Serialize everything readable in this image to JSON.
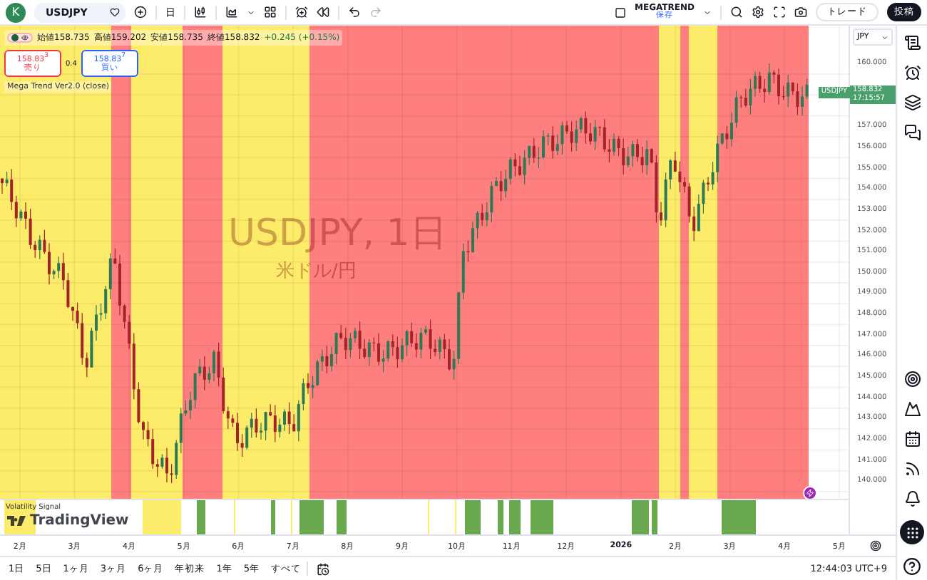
{
  "toolbar": {
    "avatar": "K",
    "symbol": "USDJPY",
    "interval": "日",
    "layout_name": "MEGATREND",
    "layout_status": "保存",
    "trade_button": "トレード",
    "publish_button": "投稿"
  },
  "legend": {
    "visible": true,
    "ohlc": [
      {
        "label": "始値",
        "value": "158.735"
      },
      {
        "label": "高値",
        "value": "159.202"
      },
      {
        "label": "安値",
        "value": "158.735"
      },
      {
        "label": "終値",
        "value": "158.832"
      }
    ],
    "change": "+0.245 (+0.15%)",
    "sell": {
      "price": "158.83$^{3}$",
      "label": "売り"
    },
    "spread": "0.4",
    "buy": {
      "price": "158.83$^{7}$",
      "label": "買い"
    },
    "indicator": "Mega Trend Ver2.0 (close)"
  },
  "watermark": {
    "symbol": "USDJPY, 1日",
    "name": "米ドル/円"
  },
  "price_axis": {
    "currency": "JPY",
    "ticks_above": [
      "160.000"
    ],
    "ticks": [
      "157.000",
      "156.000",
      "155.000",
      "154.000",
      "153.000",
      "152.000",
      "151.000",
      "150.000",
      "149.000",
      "148.000",
      "147.000",
      "146.000",
      "145.000",
      "144.000",
      "143.000",
      "142.000",
      "141.000",
      "140.000"
    ],
    "last_price": {
      "symbol": "USDJPY",
      "price": "158.832",
      "countdown": "17:15:57"
    }
  },
  "indicator_pane": {
    "title": "Volatility Signal",
    "logo_text": "TradingView"
  },
  "time_axis": {
    "labels": [
      {
        "text": "2月",
        "year": false
      },
      {
        "text": "3月",
        "year": false
      },
      {
        "text": "4月",
        "year": false
      },
      {
        "text": "5月",
        "year": false
      },
      {
        "text": "6月",
        "year": false
      },
      {
        "text": "7月",
        "year": false
      },
      {
        "text": "8月",
        "year": false
      },
      {
        "text": "9月",
        "year": false
      },
      {
        "text": "10月",
        "year": false
      },
      {
        "text": "11月",
        "year": false
      },
      {
        "text": "12月",
        "year": false
      },
      {
        "text": "2026",
        "year": true
      },
      {
        "text": "2月",
        "year": false
      },
      {
        "text": "3月",
        "year": false
      },
      {
        "text": "4月",
        "year": false
      },
      {
        "text": "5月",
        "year": false
      }
    ]
  },
  "range_buttons": [
    "1日",
    "5日",
    "1ヶ月",
    "3ヶ月",
    "6ヶ月",
    "年初来",
    "1年",
    "5年",
    "すべて"
  ],
  "clock": "12:44:03 UTC+9"
}
